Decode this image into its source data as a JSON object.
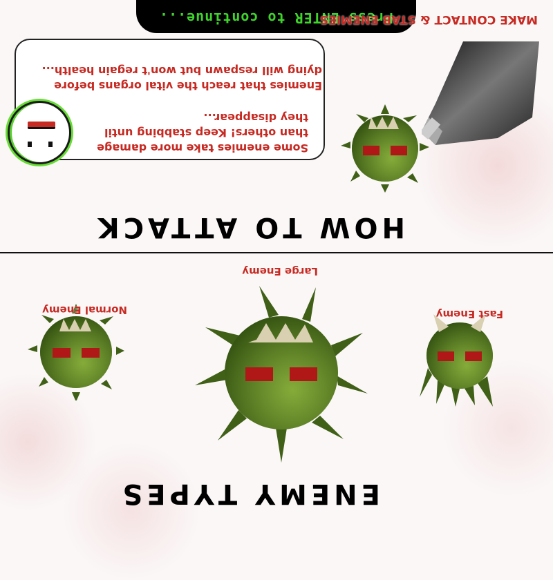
{
  "sections": {
    "attack_title": "HOW TO ATTACK",
    "enemy_types_title": "ENEMY TYPES"
  },
  "attack": {
    "header": "MAKE CONTACT & STAB ENEMIES",
    "bubble_lines": [
      "dying will respawn but won't regain health...",
      "Enemies that reach the vital organs before",
      "they disappear...",
      "than others! Keep stabbing until",
      "Some enemies take more damage"
    ]
  },
  "enemies": {
    "normal_label": "Normal Enemy",
    "large_label": "Large Enemy",
    "fast_label": "Fast Enemy"
  },
  "prompt": {
    "continue_text": "Press ENTER to continue..."
  },
  "colors": {
    "label_red": "#c62a22",
    "enemy_green": "#5a7f1f",
    "prompt_green": "#3ed42b",
    "background": "#fbf7f7"
  },
  "note_orientation": "rotated 180 degrees"
}
